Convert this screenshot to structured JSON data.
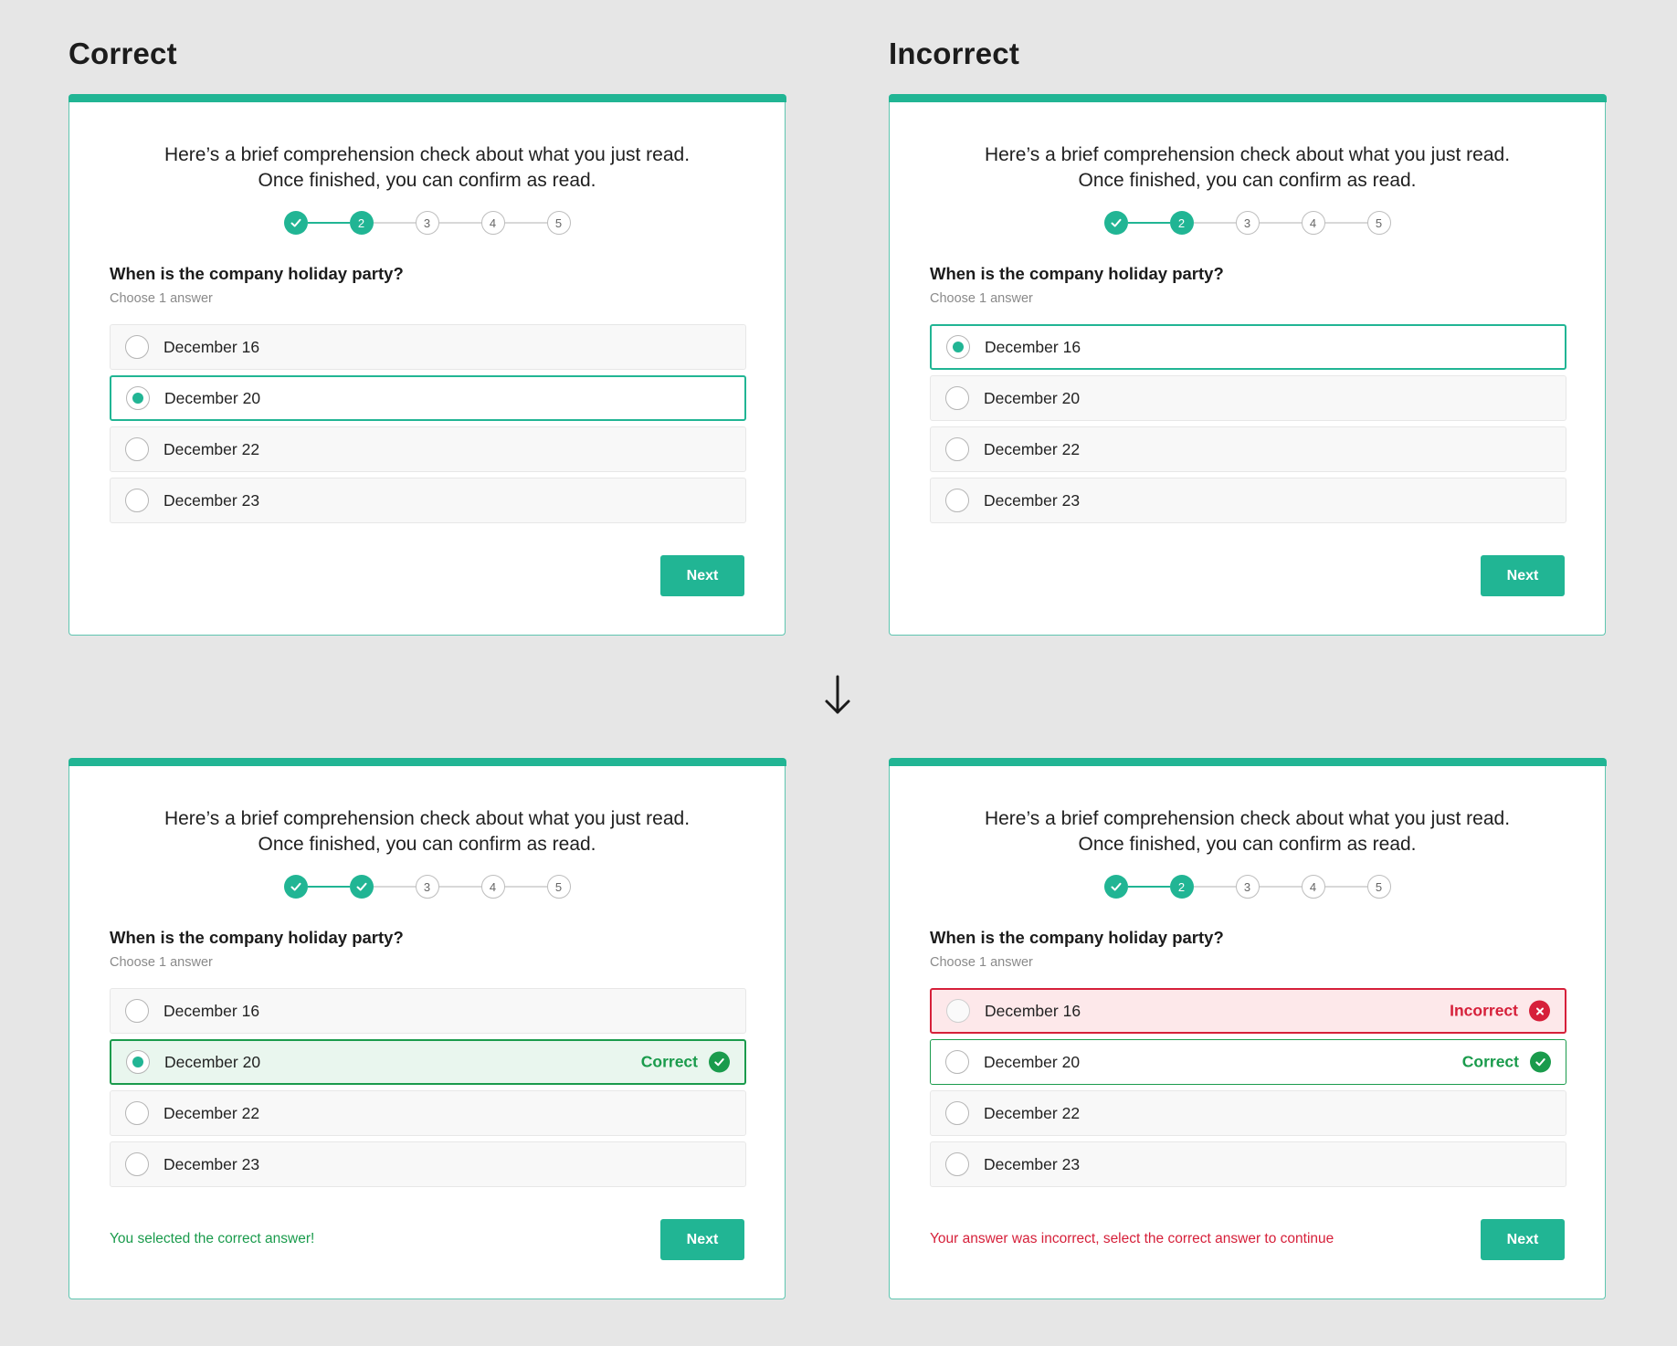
{
  "columns": {
    "left_title": "Correct",
    "right_title": "Incorrect"
  },
  "quiz": {
    "intro_line1": "Here’s a brief comprehension check about what you just read.",
    "intro_line2": "Once finished, you can confirm as read.",
    "question": "When is the company holiday party?",
    "hint": "Choose 1 answer",
    "options": [
      "December 16",
      "December 20",
      "December 22",
      "December 23"
    ],
    "steps": [
      "1",
      "2",
      "3",
      "4",
      "5"
    ],
    "next_label": "Next",
    "correct_label": "Correct",
    "incorrect_label": "Incorrect"
  },
  "messages": {
    "correct": "You selected the correct answer!",
    "incorrect": "Your answer was incorrect, select the correct answer to continue"
  },
  "colors": {
    "accent": "#21b594",
    "success": "#1a9b4c",
    "error": "#d6203a",
    "background": "#e6e6e6"
  },
  "icons": [
    "check-icon",
    "x-icon",
    "down-arrow-icon"
  ]
}
